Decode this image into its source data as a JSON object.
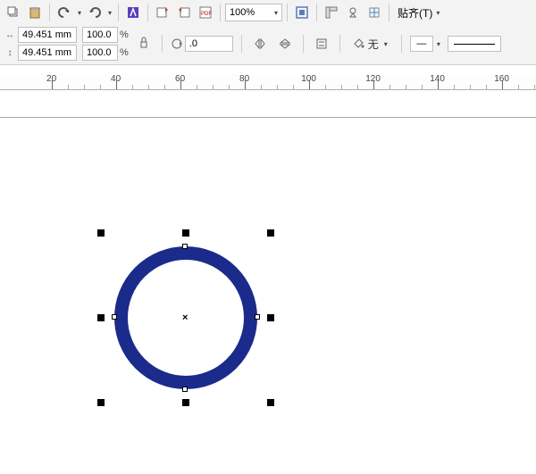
{
  "toolbar": {
    "zoom": "100%",
    "snap_label": "贴齐(T)"
  },
  "props": {
    "width": "49.451 mm",
    "height": "49.451 mm",
    "scale_x": "100.0",
    "scale_y": "100.0",
    "rotation": ".0",
    "fill_label": "无",
    "stroke_width": "—"
  },
  "ruler": {
    "ticks": [
      20,
      40,
      60,
      80,
      100,
      120,
      140,
      160
    ]
  },
  "icons": {
    "copy": "copy-icon",
    "paste": "paste-icon",
    "undo": "undo-icon",
    "redo": "redo-icon",
    "launch": "launch-icon",
    "import": "import-icon",
    "export": "export-icon",
    "pdf": "pdf-icon",
    "fullscreen": "fullscreen-icon",
    "rulers": "rulers-icon",
    "guides": "guides-icon",
    "grid": "grid-icon",
    "width_dim": "width-dim-icon",
    "height_dim": "height-dim-icon",
    "lock_ratio": "lock-ratio-icon",
    "rotate": "rotate-icon",
    "mirror_h": "mirror-h-icon",
    "mirror_v": "mirror-v-icon",
    "to_front": "to-front-icon",
    "outline": "outline-icon",
    "fill_bucket": "fill-bucket-icon"
  }
}
